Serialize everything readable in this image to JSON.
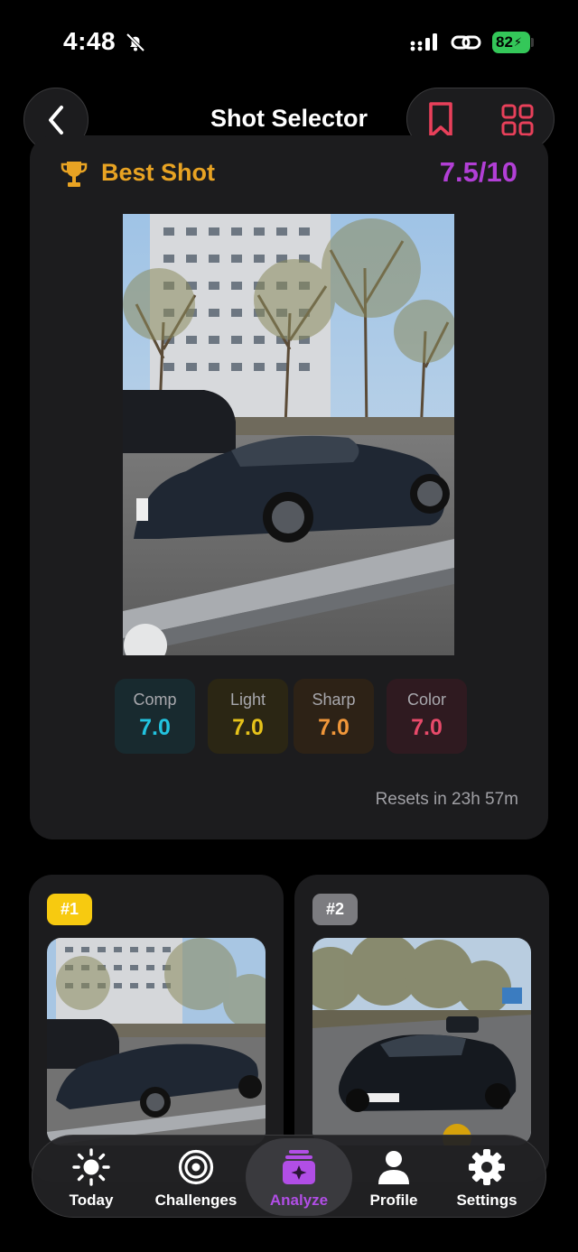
{
  "status_bar": {
    "time": "4:48",
    "battery_percent": "82"
  },
  "header": {
    "title": "Shot Selector"
  },
  "best_shot": {
    "label": "Best Shot",
    "score": "7.5/10",
    "metrics": [
      {
        "label": "Comp",
        "value": "7.0",
        "color": "#22c3df"
      },
      {
        "label": "Light",
        "value": "7.0",
        "color": "#e6c21a"
      },
      {
        "label": "Sharp",
        "value": "7.0",
        "color": "#f0973a"
      },
      {
        "label": "Color",
        "value": "7.0",
        "color": "#e84a6a"
      }
    ],
    "resets_text": "Resets in 23h 57m"
  },
  "thumbnails": [
    {
      "rank": "#1",
      "badge_color": "#f7ca10"
    },
    {
      "rank": "#2",
      "badge_color": "#7c7c80"
    }
  ],
  "tab_bar": {
    "active": "Analyze",
    "tabs": [
      {
        "label": "Today",
        "icon": "sun-icon"
      },
      {
        "label": "Challenges",
        "icon": "target-icon"
      },
      {
        "label": "Analyze",
        "icon": "sparkle-stack-icon"
      },
      {
        "label": "Profile",
        "icon": "person-icon"
      },
      {
        "label": "Settings",
        "icon": "gear-icon"
      }
    ]
  },
  "colors": {
    "accent_purple": "#b14ee6",
    "best_shot_gold": "#e8a323",
    "header_red": "#e8405a",
    "card_bg": "#1c1c1e"
  }
}
